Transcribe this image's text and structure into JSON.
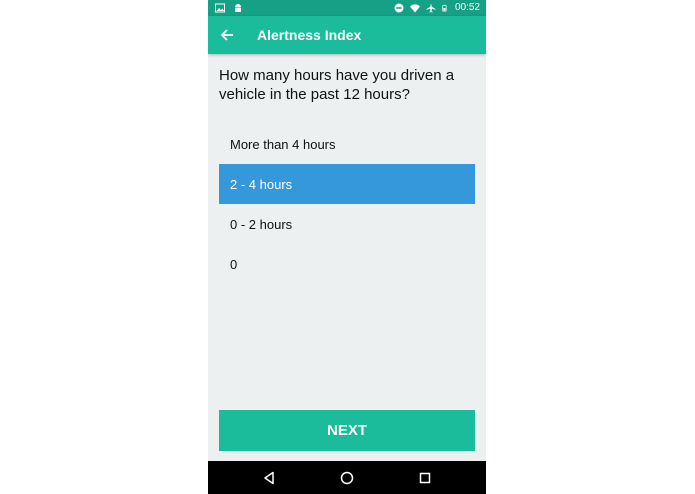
{
  "status_bar": {
    "time": "00:52",
    "left_icons": [
      "image-icon",
      "android-icon"
    ],
    "right_icons": [
      "do-not-disturb-icon",
      "wifi-icon",
      "airplane-icon",
      "battery-icon"
    ]
  },
  "app_bar": {
    "title": "Alertness Index",
    "back_icon": "arrow-left-icon"
  },
  "question": {
    "text": "How many hours have you driven a vehicle in the past 12 hours?"
  },
  "options": [
    {
      "label": "More than 4 hours",
      "selected": false
    },
    {
      "label": "2 - 4 hours",
      "selected": true
    },
    {
      "label": "0 - 2 hours",
      "selected": false
    },
    {
      "label": "0",
      "selected": false
    }
  ],
  "next_button": {
    "label": "NEXT"
  },
  "nav_bar": {
    "icons": [
      "back-triangle-icon",
      "home-circle-icon",
      "recents-square-icon"
    ]
  },
  "colors": {
    "status_bar": "#16a085",
    "app_bar": "#1abc9c",
    "selected_option": "#3498db",
    "background": "#ecf0f1",
    "next_button": "#1abc9c"
  }
}
